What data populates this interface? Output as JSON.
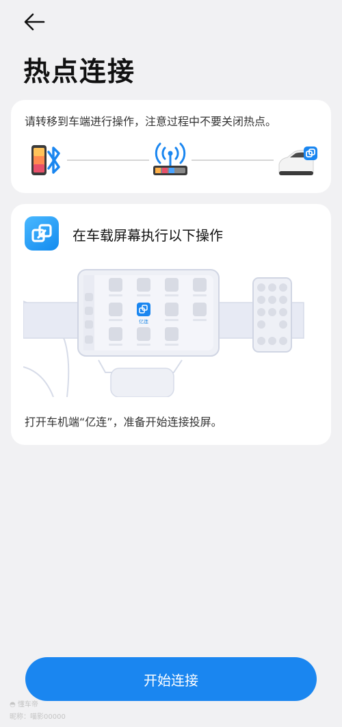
{
  "header": {
    "back_icon": "arrow-left-icon",
    "title": "热点连接"
  },
  "card1": {
    "hint": "请转移到车端进行操作，注意过程中不要关闭热点。",
    "icons": [
      "phone-icon",
      "bluetooth-icon",
      "hotspot-icon",
      "car-icon",
      "link-icon"
    ]
  },
  "card2": {
    "app_icon": "yilian-app-icon",
    "title": "在车载屏幕执行以下操作",
    "screen_app_label": "亿连",
    "description": "打开车机端“亿连”，准备开始连接投屏。"
  },
  "footer": {
    "start_label": "开始连接"
  },
  "watermark": {
    "brand": "懂车帝",
    "line2": "昵称：喵影00000"
  },
  "colors": {
    "accent": "#1a86f0",
    "background": "#f1f1f3",
    "card": "#ffffff"
  }
}
